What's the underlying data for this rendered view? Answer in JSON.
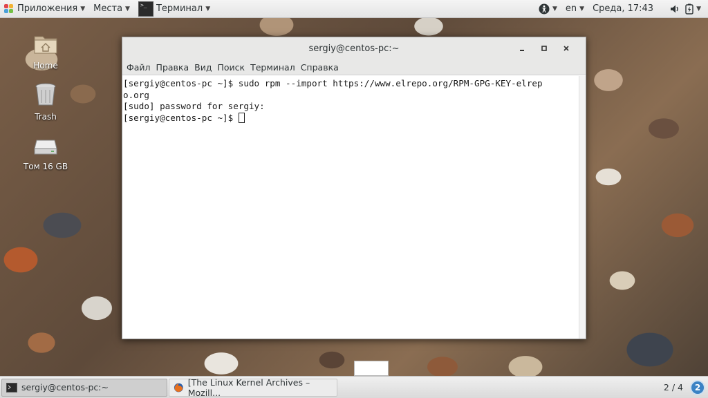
{
  "topbar": {
    "apps_label": "Приложения",
    "places_label": "Места",
    "terminal_label": "Терминал",
    "lang": "en",
    "clock": "Среда, 17:43"
  },
  "desktop": {
    "icons": [
      {
        "label": "Home"
      },
      {
        "label": "Trash"
      },
      {
        "label": "Том 16 GB"
      }
    ]
  },
  "window": {
    "title": "sergiy@centos-pc:~",
    "menu": [
      "Файл",
      "Правка",
      "Вид",
      "Поиск",
      "Терминал",
      "Справка"
    ],
    "terminal_lines": [
      "[sergiy@centos-pc ~]$ sudo rpm --import https://www.elrepo.org/RPM-GPG-KEY-elrep",
      "o.org",
      "[sudo] password for sergiy:",
      "[sergiy@centos-pc ~]$ "
    ]
  },
  "taskbar": {
    "tasks": [
      {
        "label": "sergiy@centos-pc:~"
      },
      {
        "label": "[The Linux Kernel Archives – Mozill..."
      }
    ],
    "workspace": "2 / 4",
    "badge": "2"
  },
  "colors": {
    "accent": "#3b82c4",
    "terminal_bg": "#ffffff",
    "panel_bg": "#ececec"
  }
}
